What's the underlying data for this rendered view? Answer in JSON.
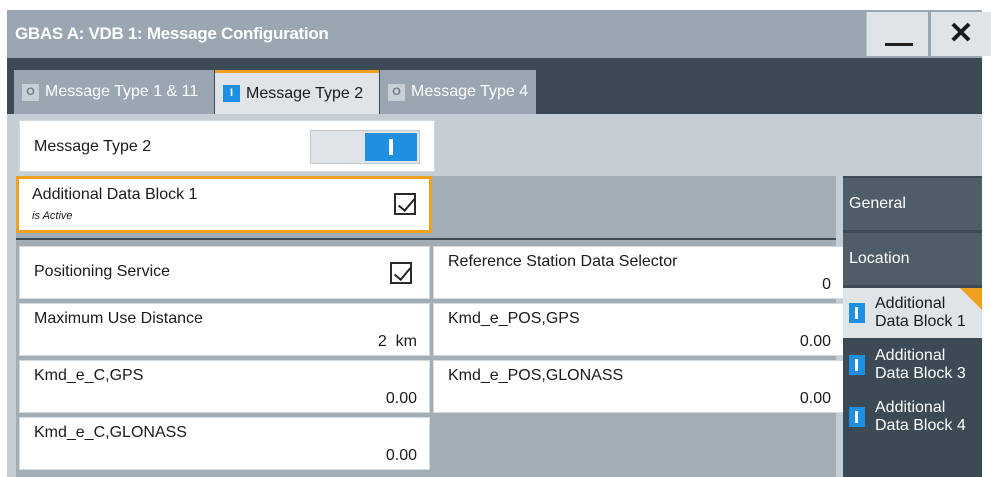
{
  "window": {
    "title": "GBAS A: VDB 1: Message Configuration",
    "minimize_icon": "minimize-icon",
    "close_icon": "close-icon"
  },
  "tabs": [
    {
      "label": "Message Type 1 & 11",
      "indicator": "O",
      "active": false
    },
    {
      "label": "Message Type 2",
      "indicator": "I",
      "active": true
    },
    {
      "label": "Message Type 4",
      "indicator": "O",
      "active": false
    }
  ],
  "message_type": {
    "label": "Message Type 2",
    "toggle_state": "on"
  },
  "additional_data_block": {
    "title": "Additional Data Block 1",
    "subtitle": "is Active",
    "checked": true
  },
  "fields": {
    "positioning_service": {
      "label": "Positioning Service",
      "checked": true
    },
    "ref_station_selector": {
      "label": "Reference Station Data Selector",
      "value": "0"
    },
    "max_use_distance": {
      "label": "Maximum Use Distance",
      "value": "2  km"
    },
    "kmd_e_pos_gps": {
      "label": "Kmd_e_POS,GPS",
      "value": "0.00"
    },
    "kmd_e_c_gps": {
      "label": "Kmd_e_C,GPS",
      "value": "0.00"
    },
    "kmd_e_pos_glonass": {
      "label": "Kmd_e_POS,GLONASS",
      "value": "0.00"
    },
    "kmd_e_c_glonass": {
      "label": "Kmd_e_C,GLONASS",
      "value": "0.00"
    }
  },
  "side_nav": {
    "general": "General",
    "location": "Location",
    "adb1": {
      "line1": "Additional",
      "line2": "Data Block 1"
    },
    "adb3": {
      "line1": "Additional",
      "line2": "Data Block 3"
    },
    "adb4": {
      "line1": "Additional",
      "line2": "Data Block 4"
    }
  },
  "colors": {
    "accent": "#f0a01f",
    "active_blue": "#1e8fe1",
    "dark_panel": "#3b4a55",
    "title_bar": "#9aa7b2"
  }
}
